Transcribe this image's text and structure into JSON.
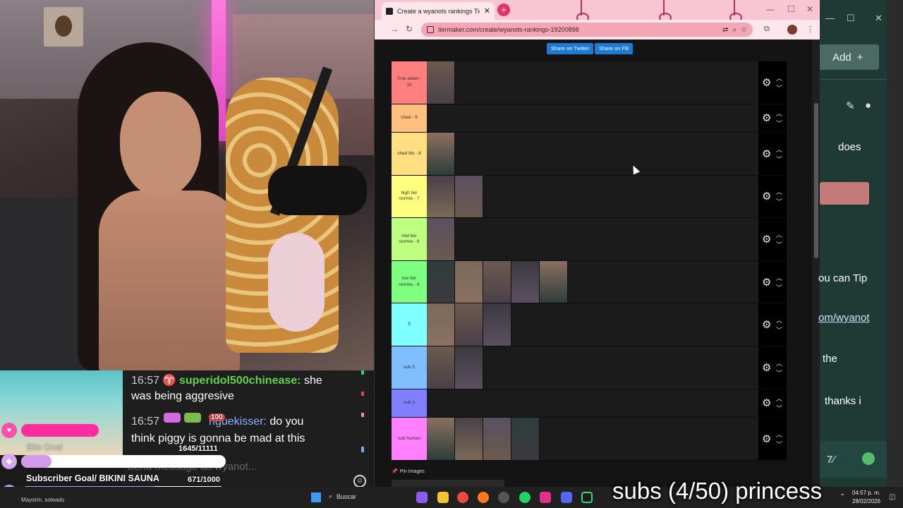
{
  "browser": {
    "tab_title": "Create a wyanots rankings Tier",
    "url": "tiermaker.com/create/wyanots-rankings-19200898"
  },
  "tiermaker": {
    "share_twitter": "Share on Twitter",
    "share_fb": "Share on FB",
    "pin_images": "Pin Images",
    "tiers": [
      {
        "label": "True adam - 10",
        "color": "#ff7f7f",
        "images": 1
      },
      {
        "label": "chad - 9",
        "color": "#ffbf7f",
        "images": 0
      },
      {
        "label": "chad lite - 8",
        "color": "#ffdf7f",
        "images": 1
      },
      {
        "label": "high tier normie - 7",
        "color": "#ffff7f",
        "images": 2
      },
      {
        "label": "mid tier normie - 6",
        "color": "#bfff7f",
        "images": 1
      },
      {
        "label": "low tier normie - 6",
        "color": "#7fff7f",
        "images": 5
      },
      {
        "label": "5",
        "color": "#7fffff",
        "images": 3
      },
      {
        "label": "sub 5",
        "color": "#7fbfff",
        "images": 2
      },
      {
        "label": "sub 3",
        "color": "#7f7fff",
        "images": 0
      },
      {
        "label": "sub human",
        "color": "#ff7fff",
        "images": 4
      }
    ]
  },
  "chat": {
    "line1_time": "16:57",
    "line1_user": "superidol500chinease:",
    "line1_msg": "she",
    "line1_cont": "was being aggresive",
    "line2_time": "16:57",
    "line2_user": "nguekisser:",
    "line2_msg": "do you",
    "line2_cont": "think piggy is gonna be mad at this",
    "input_placeholder": "Send message as wyanot..."
  },
  "goals": {
    "bits_label": "Bits Goal",
    "bits_count": "1645/11111",
    "bits_progress": 0.148,
    "bits_badge": "100",
    "sub_title": "Subscriber Goal/ BIKINI SAUNA",
    "sub_count": "671/1000",
    "sub_progress": 0.671
  },
  "right_panel": {
    "add_label": "Add",
    "text1": "does",
    "text2": "ou can Tip",
    "text3": "om/wyanot",
    "text4": "the",
    "text5": "thanks i"
  },
  "overlay": {
    "subs_banner": "subs (4/50) princess"
  },
  "taskbar": {
    "weather": "Mayorm. soleado",
    "search": "Buscar",
    "time": "04:57 p. m.",
    "date": "28/02/2026"
  }
}
